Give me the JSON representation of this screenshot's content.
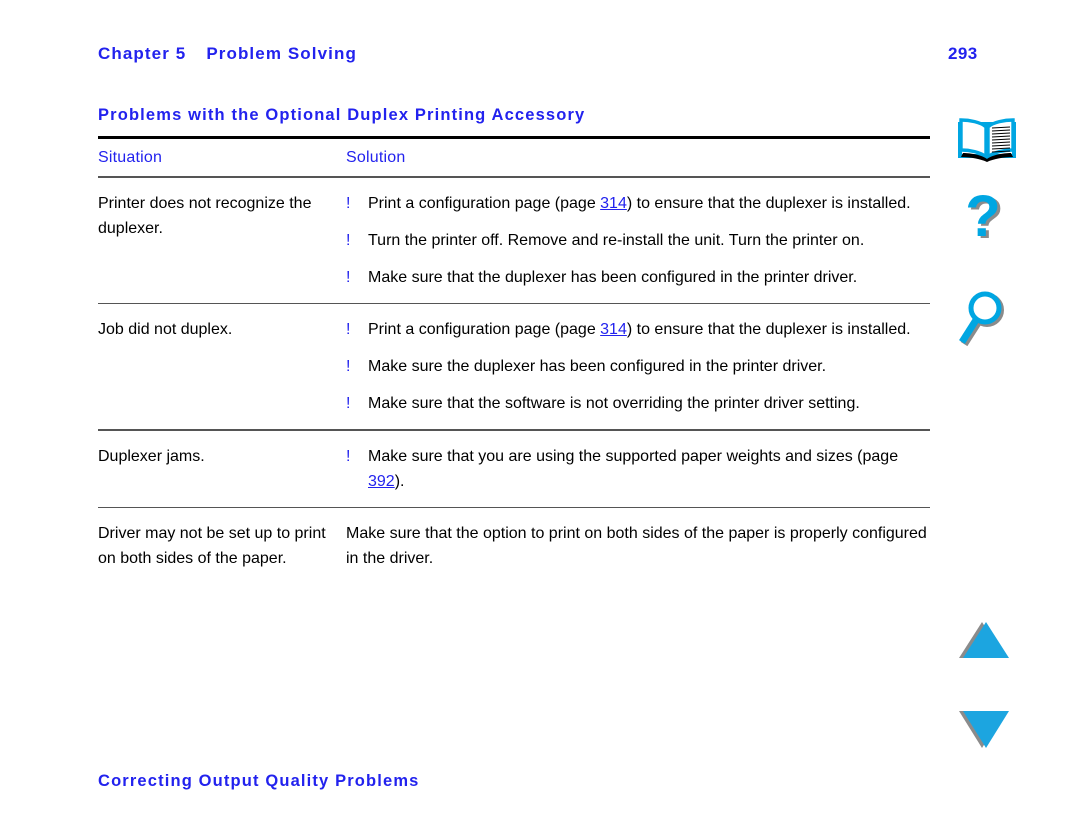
{
  "header": {
    "chapter": "Chapter 5",
    "title": "Problem Solving",
    "page_number": "293"
  },
  "section_heading": "Problems with the Optional Duplex Printing Accessory",
  "footer_heading": "Correcting Output Quality Problems",
  "colors": {
    "link_blue": "#2222ee",
    "icon_cyan": "#00a6e2",
    "text_black": "#000000"
  },
  "table": {
    "columns": [
      "Situation",
      "Solution"
    ],
    "bullet_marker": "!",
    "rows": [
      {
        "situation": "Printer does not recognize the duplexer.",
        "bulleted": true,
        "solutions": [
          {
            "before": "Print a configuration page (page ",
            "link": "314",
            "after": ") to ensure that the duplexer is installed."
          },
          {
            "before": "Turn the printer off. Remove and re-install the unit. Turn the printer on.",
            "link": "",
            "after": ""
          },
          {
            "before": "Make sure that the duplexer has been configured in the printer driver.",
            "link": "",
            "after": ""
          }
        ]
      },
      {
        "situation": "Job did not duplex.",
        "bulleted": true,
        "solutions": [
          {
            "before": "Print a configuration page (page ",
            "link": "314",
            "after": ") to ensure that the duplexer is installed."
          },
          {
            "before": "Make sure the duplexer has been configured in the printer driver.",
            "link": "",
            "after": ""
          },
          {
            "before": "Make sure that the software is not overriding the printer driver setting.",
            "link": "",
            "after": ""
          }
        ]
      },
      {
        "situation": "Duplexer jams.",
        "bulleted": true,
        "solutions": [
          {
            "before": "Make sure that you are using the supported paper weights and sizes (page ",
            "link": "392",
            "after": ")."
          }
        ]
      },
      {
        "situation": "Driver may not be set up to print on both sides of the paper.",
        "bulleted": false,
        "solutions": [
          {
            "before": "Make sure that the option to print on both sides of the paper is properly configured in the driver.",
            "link": "",
            "after": ""
          }
        ]
      }
    ]
  },
  "nav_rail": {
    "icons": [
      {
        "name": "book-icon",
        "label": "Contents"
      },
      {
        "name": "question-icon",
        "label": "Help"
      },
      {
        "name": "magnifier-icon",
        "label": "Search"
      },
      {
        "name": "arrow-up-icon",
        "label": "Previous page"
      },
      {
        "name": "arrow-down-icon",
        "label": "Next page"
      }
    ]
  }
}
